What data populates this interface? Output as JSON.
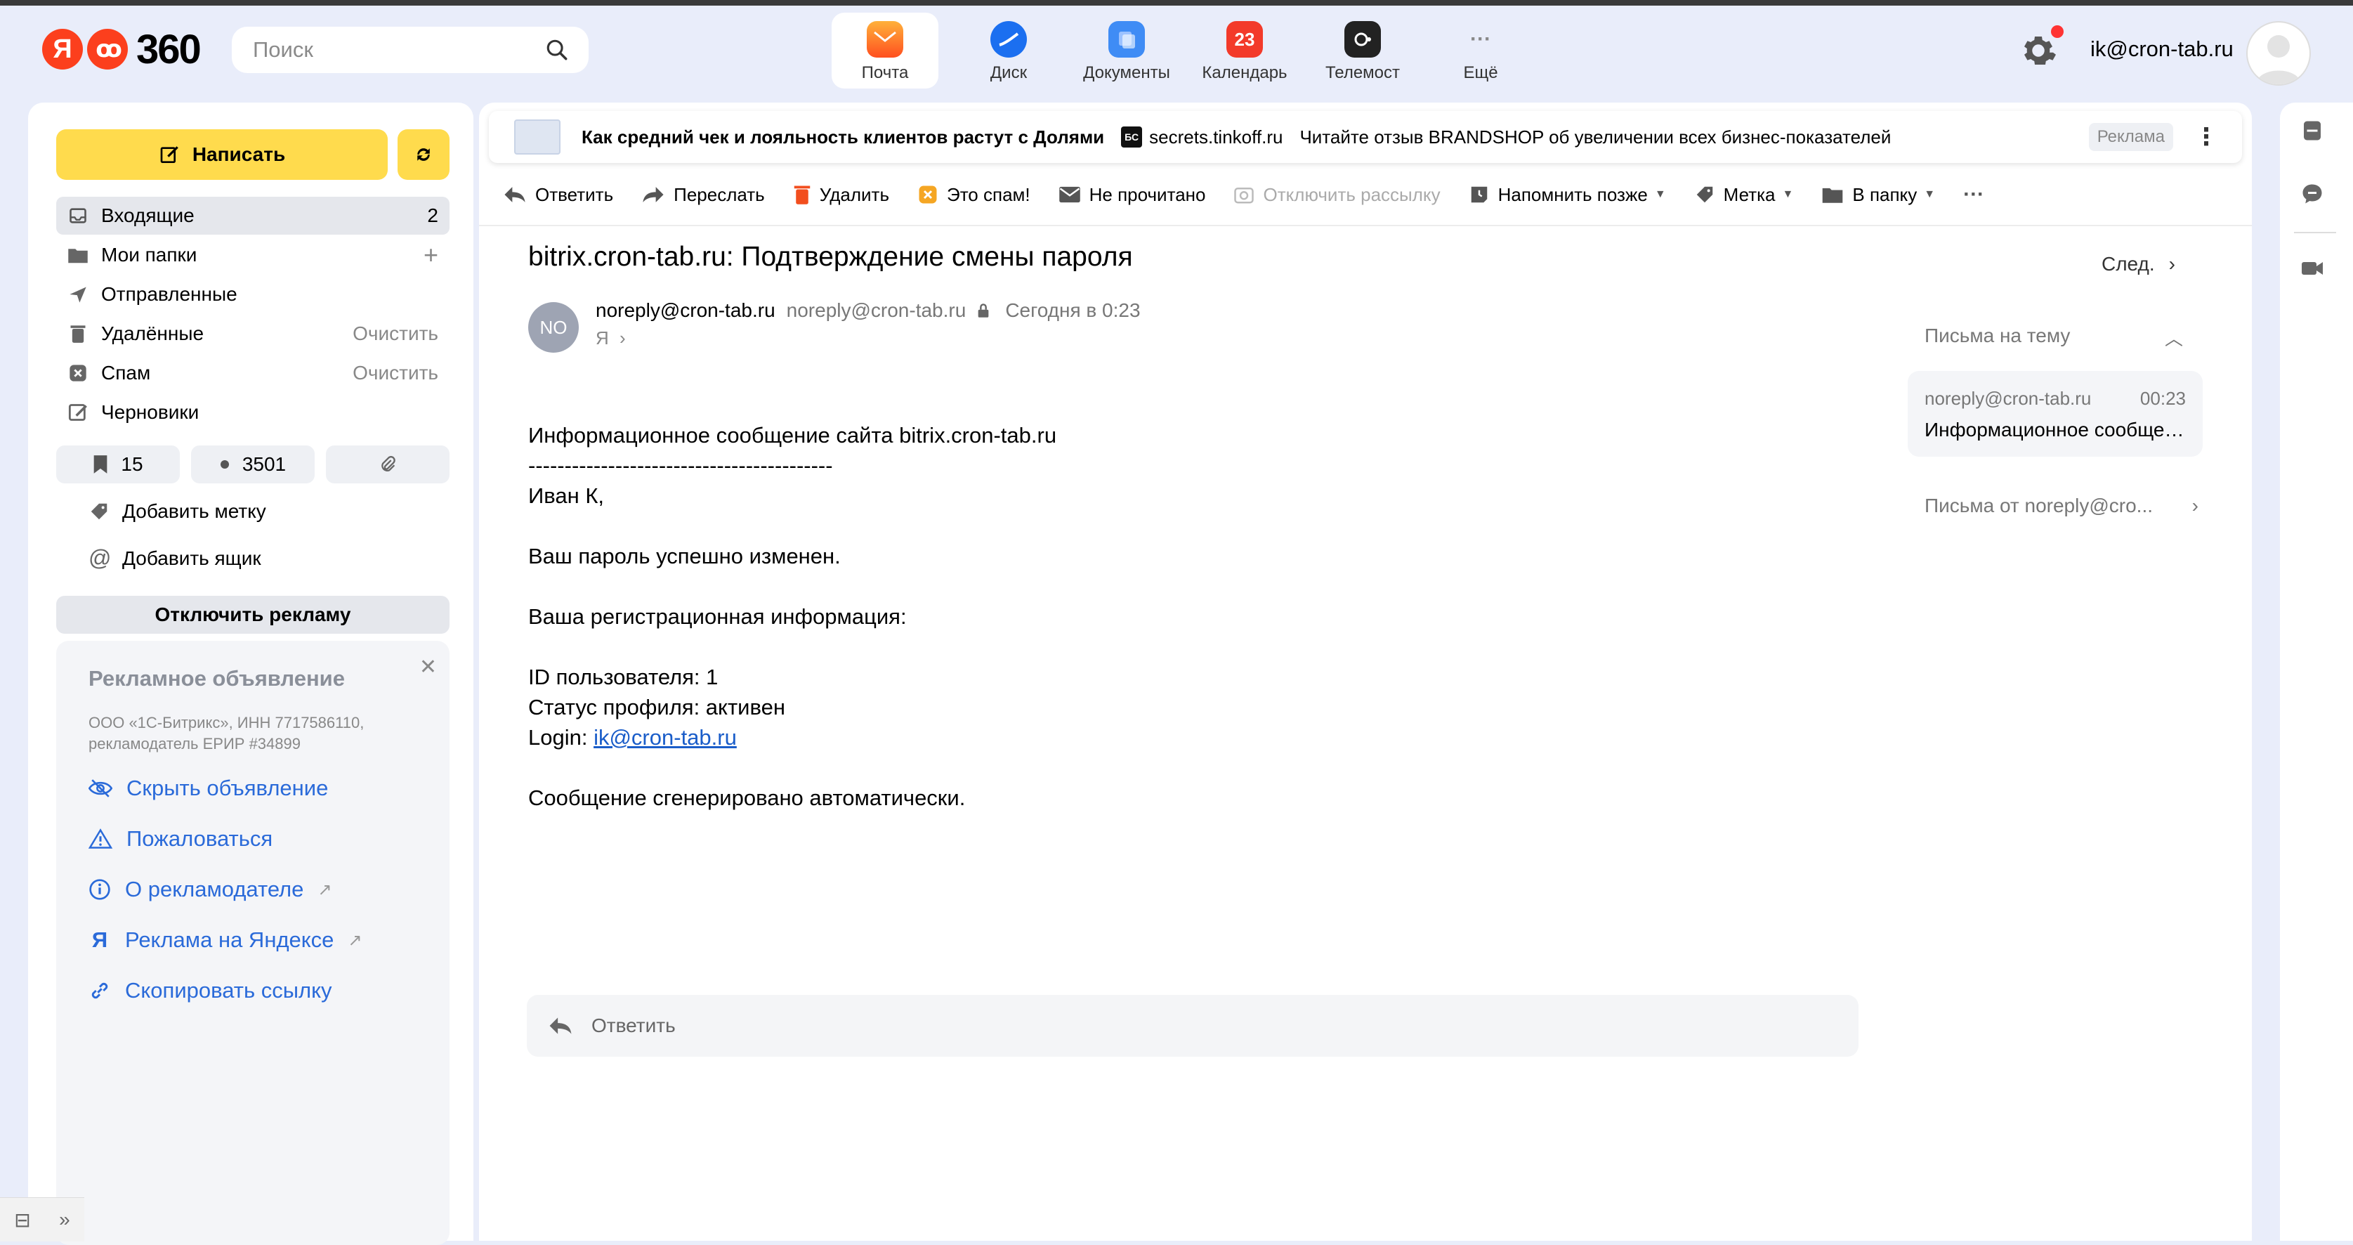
{
  "header": {
    "logo_text": "360",
    "logo_ya": "Я",
    "search_placeholder": "Поиск",
    "user_email": "ik@cron-tab.ru"
  },
  "apps": [
    {
      "label": "Почта",
      "icon": "mail-icon",
      "color": "#ff5a1f",
      "active": true
    },
    {
      "label": "Диск",
      "icon": "disk-icon",
      "color": "#1b6ff0",
      "active": false
    },
    {
      "label": "Документы",
      "icon": "documents-icon",
      "color": "#3f8cf5",
      "active": false
    },
    {
      "label": "Календарь",
      "icon": "calendar-icon",
      "badge": "23",
      "color": "#f33a2a",
      "active": false
    },
    {
      "label": "Телемост",
      "icon": "telemost-icon",
      "color": "#222222",
      "active": false
    },
    {
      "label": "Ещё",
      "icon": "more-icon",
      "color": "#888888",
      "active": false
    }
  ],
  "sidebar": {
    "compose_label": "Написать",
    "folders": [
      {
        "label": "Входящие",
        "count": "2",
        "icon": "inbox-icon"
      },
      {
        "label": "Мои папки",
        "count": "+",
        "icon": "folder-icon"
      },
      {
        "label": "Отправленные",
        "count": "",
        "icon": "sent-icon"
      },
      {
        "label": "Удалённые",
        "count": "Очистить",
        "icon": "trash-icon"
      },
      {
        "label": "Спам",
        "count": "Очистить",
        "icon": "spam-icon"
      },
      {
        "label": "Черновики",
        "count": "",
        "icon": "drafts-icon"
      }
    ],
    "chips": {
      "bookmarks": "15",
      "unread": "3501"
    },
    "add_label": "Добавить метку",
    "add_mailbox": "Добавить ящик",
    "disable_ads": "Отключить рекламу",
    "ad": {
      "title": "Рекламное объявление",
      "legal": "ООО «1С-Битрикс», ИНН 7717586110, рекламодатель ЕРИР #34899",
      "links": [
        "Скрыть объявление",
        "Пожаловаться",
        "О рекламодателе",
        "Реклама на Яндексе",
        "Скопировать ссылку"
      ]
    }
  },
  "adbar": {
    "headline": "Как средний чек и лояльность клиентов растут с Долями",
    "badge": "БС",
    "domain": "secrets.tinkoff.ru",
    "text": "Читайте отзыв BRANDSHOP об увеличении всех бизнес-показателей",
    "tag": "Реклама"
  },
  "toolbar": {
    "reply": "Ответить",
    "forward": "Переслать",
    "delete": "Удалить",
    "spam": "Это спам!",
    "unread": "Не прочитано",
    "unsubscribe": "Отключить рассылку",
    "remind": "Напомнить позже",
    "label": "Метка",
    "to_folder": "В папку"
  },
  "message": {
    "subject": "bitrix.cron-tab.ru: Подтверждение смены пароля",
    "next": "След.",
    "avatar_initials": "NO",
    "sender_name": "noreply@cron-tab.ru",
    "sender_addr": "noreply@cron-tab.ru",
    "date": "Сегодня в 0:23",
    "to": "Я",
    "body": {
      "line1": "Информационное сообщение сайта bitrix.cron-tab.ru",
      "divider": "------------------------------------------",
      "greeting": "Иван К,",
      "changed": "Ваш пароль успешно изменен.",
      "reginfo": "Ваша регистрационная информация:",
      "userid": "ID пользователя: 1",
      "status": "Статус профиля: активен",
      "login_label": "Login: ",
      "login_value": "ik@cron-tab.ru",
      "auto": "Сообщение сгенерировано автоматически."
    },
    "reply_placeholder": "Ответить"
  },
  "thread": {
    "title": "Письма на тему",
    "item_from": "noreply@cron-tab.ru",
    "item_time": "00:23",
    "item_snippet": "Информационное сообщение сайта",
    "from_letters": "Письма от noreply@cro..."
  }
}
